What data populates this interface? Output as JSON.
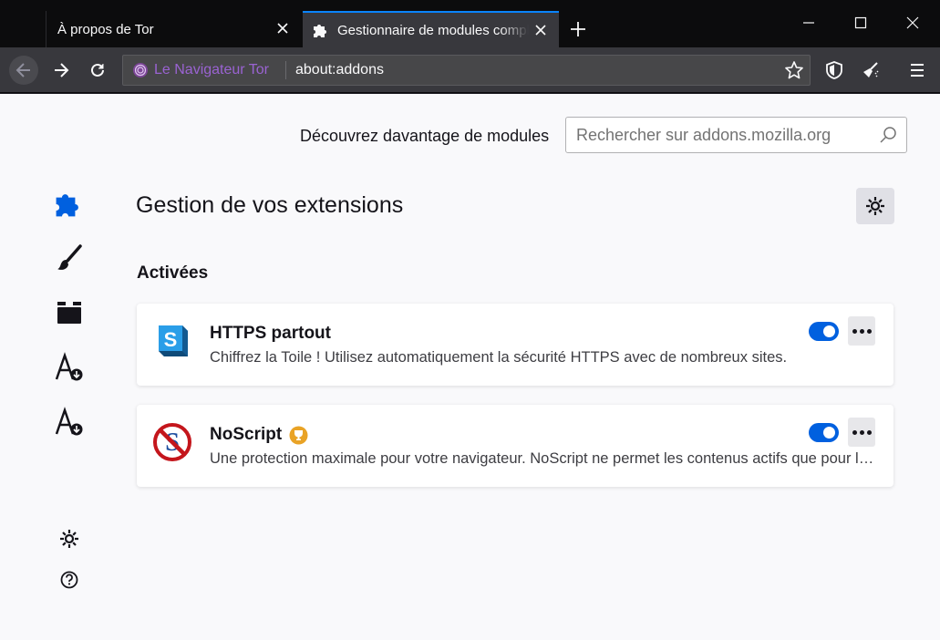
{
  "tabs": [
    {
      "label": "À propos de Tor"
    },
    {
      "label": "Gestionnaire de modules complémentaires"
    }
  ],
  "new_tab_icon": "plus-icon",
  "window_controls": [
    "minimize-icon",
    "maximize-icon",
    "close-icon"
  ],
  "nav": {
    "identity_label": "Le Navigateur Tor",
    "url": "about:addons"
  },
  "discover": {
    "label": "Découvrez davantage de modules",
    "search_placeholder": "Rechercher sur addons.mozilla.org"
  },
  "main": {
    "heading": "Gestion de vos extensions",
    "section": "Activées"
  },
  "addons": [
    {
      "name": "HTTPS partout",
      "description": "Chiffrez la Toile ! Utilisez automatiquement la sécurité HTTPS avec de nombreux sites.",
      "enabled": true
    },
    {
      "name": "NoScript",
      "description": "Une protection maximale pour votre navigateur. NoScript ne permet les contenus actifs que pour les domaines de confiance de votre choix",
      "enabled": true,
      "recommended_badge": true
    }
  ],
  "colors": {
    "accent": "#0060df",
    "tab_highlight": "#0a84ff",
    "tor_purple": "#9a63d2",
    "active_category": "#0060df"
  }
}
